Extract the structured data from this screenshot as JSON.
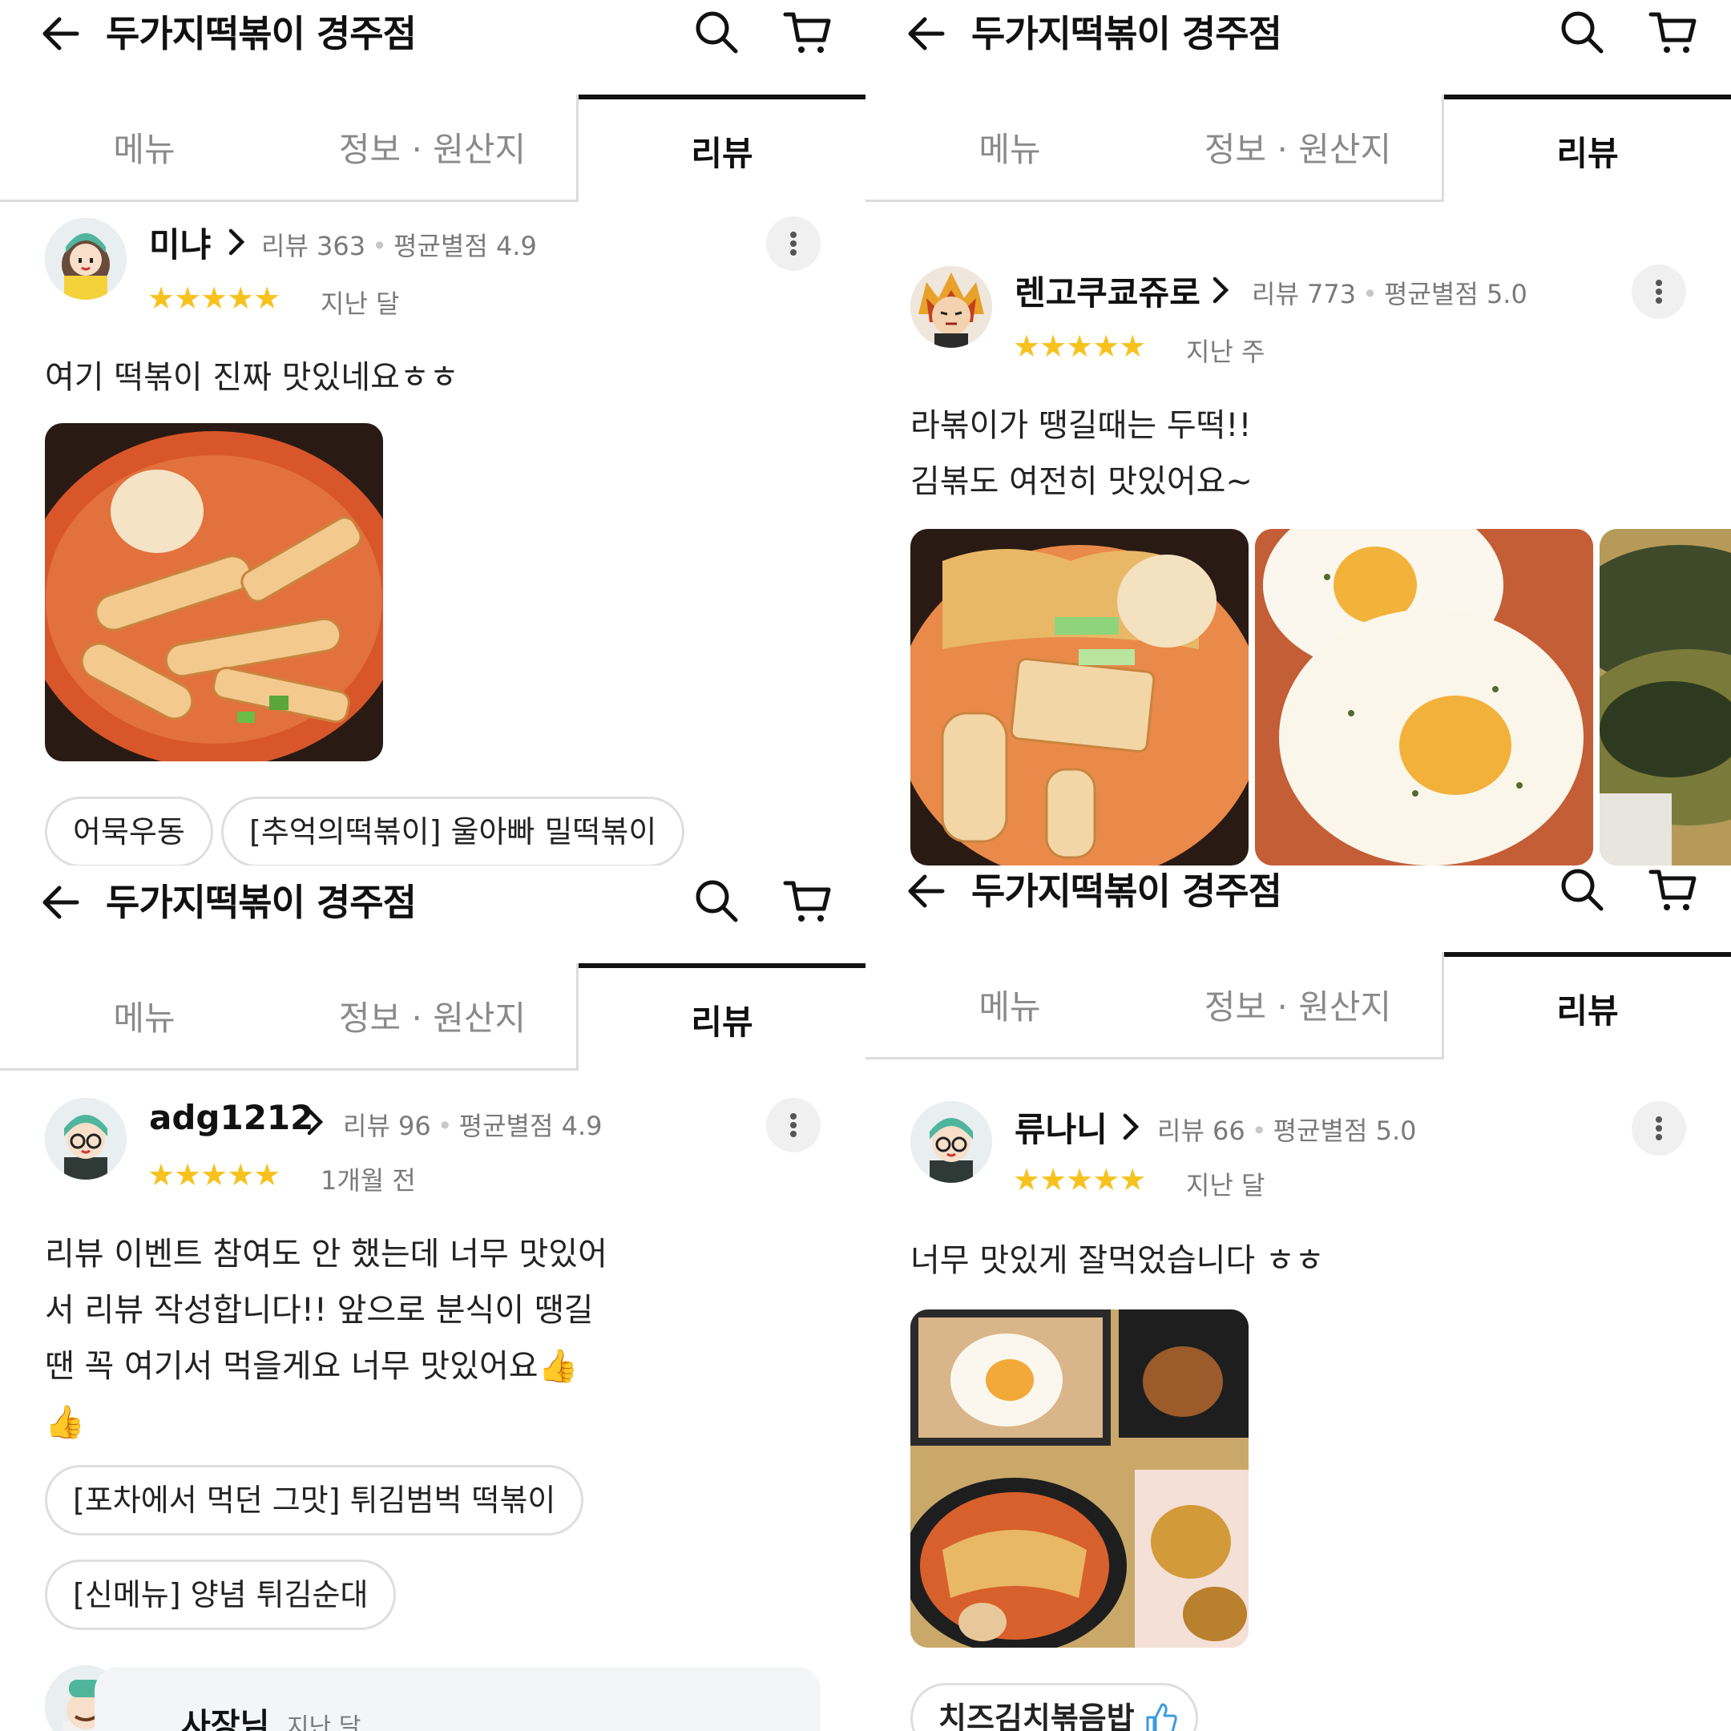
{
  "header": {
    "title": "두가지떡볶이 경주점"
  },
  "tabs": {
    "menu": "메뉴",
    "info": "정보 · 원산지",
    "review": "리뷰"
  },
  "reviews": [
    {
      "user": "미냐",
      "review_count": "리뷰 363",
      "avg_rating": "평균별점 4.9",
      "stars": "★★★★★",
      "when": "지난 달",
      "text": [
        "여기 떡볶이 진짜 맛있네요ㅎㅎ"
      ],
      "menus": [
        "어묵우동",
        "[추억의떡볶이] 울아빠 밀떡볶이"
      ]
    },
    {
      "user": "렌고쿠쿄쥬로",
      "review_count": "리뷰 773",
      "avg_rating": "평균별점 5.0",
      "stars": "★★★★★",
      "when": "지난 주",
      "text": [
        "라볶이가 땡길때는 두떡!!",
        "김볶도 여전히 맛있어요~"
      ],
      "menus": []
    },
    {
      "user": "adg1212",
      "review_count": "리뷰 96",
      "avg_rating": "평균별점 4.9",
      "stars": "★★★★★",
      "when": "1개월 전",
      "text": [
        "리뷰 이벤트 참여도 안 했는데 너무 맛있어",
        "서 리뷰 작성합니다!! 앞으로 분식이 땡길",
        "땐 꼭 여기서 먹을게요 너무 맛있어요👍",
        "👍"
      ],
      "menus": [
        "[포차에서 먹던 그맛] 튀김범벅 떡볶이",
        "[신메뉴] 양념 튀김순대"
      ],
      "owner_reply": {
        "name": "사장님",
        "when": "지난 달"
      }
    },
    {
      "user": "류나니",
      "review_count": "리뷰 66",
      "avg_rating": "평균별점 5.0",
      "stars": "★★★★★",
      "when": "지난 달",
      "text": [
        "너무 맛있게 잘먹었습니다 ㅎㅎ"
      ],
      "menus": [
        "치즈김치볶음밥"
      ]
    }
  ],
  "icons": [
    "back-arrow-icon",
    "search-icon",
    "cart-icon",
    "chevron-right-icon",
    "more-vertical-icon",
    "thumbs-up-icon"
  ],
  "colors": {
    "star": "#f7c21e",
    "active_tab_border": "#111111",
    "chip_border": "#dedede"
  }
}
